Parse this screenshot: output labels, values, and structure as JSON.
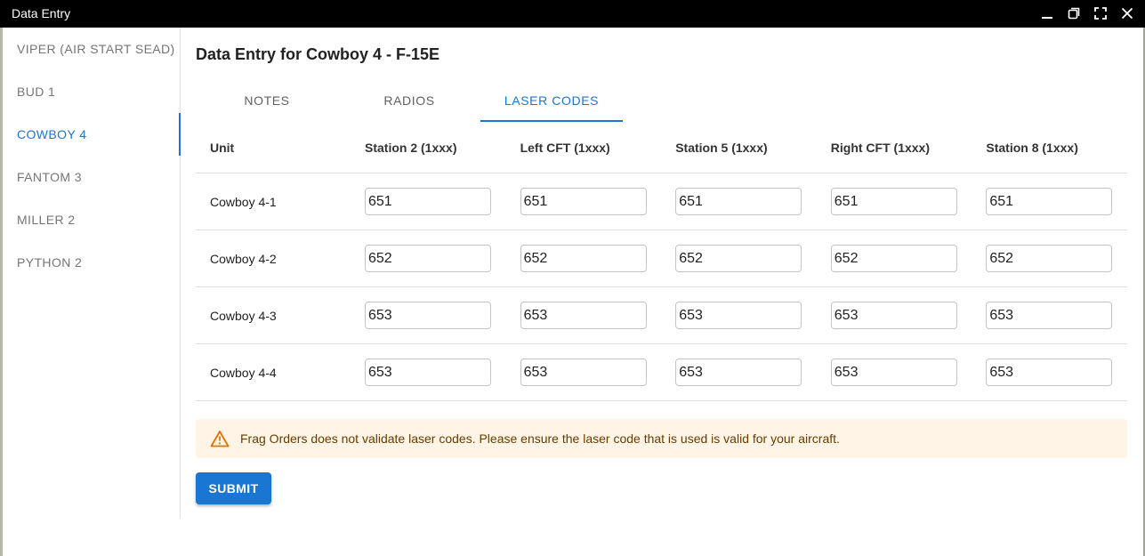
{
  "window": {
    "title": "Data Entry"
  },
  "sidebar": {
    "items": [
      {
        "label": "VIPER (AIR START SEAD)",
        "active": false
      },
      {
        "label": "BUD 1",
        "active": false
      },
      {
        "label": "COWBOY 4",
        "active": true
      },
      {
        "label": "FANTOM 3",
        "active": false
      },
      {
        "label": "MILLER 2",
        "active": false
      },
      {
        "label": "PYTHON 2",
        "active": false
      }
    ]
  },
  "main": {
    "title": "Data Entry for Cowboy 4 - F-15E",
    "tabs": [
      {
        "label": "NOTES",
        "active": false
      },
      {
        "label": "RADIOS",
        "active": false
      },
      {
        "label": "LASER CODES",
        "active": true
      }
    ],
    "table": {
      "headers": [
        "Unit",
        "Station 2 (1xxx)",
        "Left CFT (1xxx)",
        "Station 5 (1xxx)",
        "Right CFT (1xxx)",
        "Station 8 (1xxx)"
      ],
      "rows": [
        {
          "unit": "Cowboy 4-1",
          "codes": [
            "651",
            "651",
            "651",
            "651",
            "651"
          ]
        },
        {
          "unit": "Cowboy 4-2",
          "codes": [
            "652",
            "652",
            "652",
            "652",
            "652"
          ]
        },
        {
          "unit": "Cowboy 4-3",
          "codes": [
            "653",
            "653",
            "653",
            "653",
            "653"
          ]
        },
        {
          "unit": "Cowboy 4-4",
          "codes": [
            "653",
            "653",
            "653",
            "653",
            "653"
          ]
        }
      ]
    },
    "alert": {
      "icon": "warning-icon",
      "text": "Frag Orders does not validate laser codes. Please ensure the laser code that is used is valid for your aircraft."
    },
    "submit_label": "SUBMIT"
  },
  "colors": {
    "accent": "#1976d2",
    "alert_bg": "#fff4e5",
    "alert_icon": "#ed6c02",
    "titlebar": "#000000"
  }
}
